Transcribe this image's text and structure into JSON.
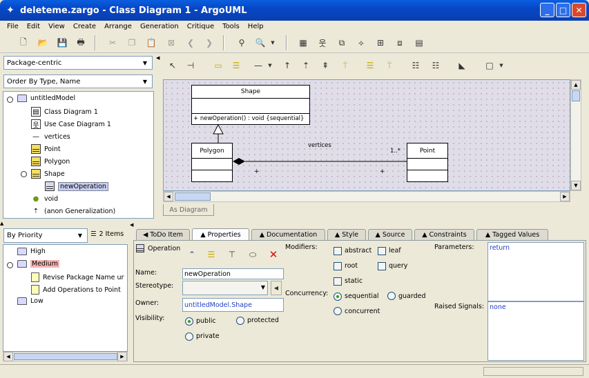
{
  "window": {
    "title": "deleteme.zargo - Class Diagram 1 - ArgoUML"
  },
  "menu": [
    "File",
    "Edit",
    "View",
    "Create",
    "Arrange",
    "Generation",
    "Critique",
    "Tools",
    "Help"
  ],
  "explorer": {
    "perspective": "Package-centric",
    "order": "Order By Type, Name",
    "items": [
      {
        "label": "untitledModel",
        "icon": "package-icon"
      },
      {
        "label": "Class Diagram 1",
        "icon": "class-diagram-icon"
      },
      {
        "label": "Use Case Diagram 1",
        "icon": "usecase-diagram-icon"
      },
      {
        "label": "vertices",
        "icon": "association-icon"
      },
      {
        "label": "Point",
        "icon": "class-icon"
      },
      {
        "label": "Polygon",
        "icon": "class-icon"
      },
      {
        "label": "Shape",
        "icon": "class-icon"
      },
      {
        "label": "newOperation",
        "icon": "operation-icon"
      },
      {
        "label": "void",
        "icon": "datatype-icon"
      },
      {
        "label": "(anon Generalization)",
        "icon": "generalization-icon"
      }
    ]
  },
  "diagram": {
    "tab": "As Diagram",
    "shape": {
      "name": "Shape",
      "operation": "+ newOperation() : void {sequential}"
    },
    "polygon": {
      "name": "Polygon"
    },
    "point": {
      "name": "Point"
    },
    "assoc": {
      "name": "vertices",
      "mult": "1..*",
      "plus1": "+",
      "plus2": "+"
    }
  },
  "todo": {
    "priority": "By Priority",
    "count": "2 Items",
    "items": [
      "High",
      "Medium",
      "Revise Package Name ur",
      "Add Operations to Point",
      "Low"
    ]
  },
  "details": {
    "tabs": [
      "ToDo Item",
      "Properties",
      "Documentation",
      "Style",
      "Source",
      "Constraints",
      "Tagged Values"
    ],
    "heading": "Operation",
    "name_label": "Name:",
    "name_value": "newOperation",
    "stereotype_label": "Stereotype:",
    "owner_label": "Owner:",
    "owner_value": "untitledModel.Shape",
    "visibility_label": "Visibility:",
    "vis": {
      "public": "public",
      "protected": "protected",
      "private": "private"
    },
    "modifiers_label": "Modifiers:",
    "mods": {
      "abstract": "abstract",
      "leaf": "leaf",
      "root": "root",
      "query": "query",
      "static": "static"
    },
    "concurrency_label": "Concurrency:",
    "conc": {
      "sequential": "sequential",
      "guarded": "guarded",
      "concurrent": "concurrent"
    },
    "parameters_label": "Parameters:",
    "parameters_value": "return",
    "raised_label": "Raised Signals:",
    "raised_value": "none"
  }
}
